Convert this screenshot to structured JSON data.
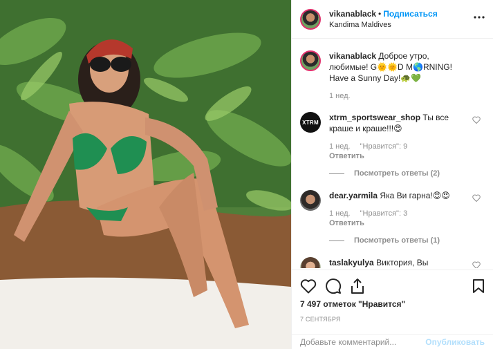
{
  "post": {
    "username": "vikanablack",
    "dot": "•",
    "follow_label": "Подписаться",
    "location": "Kandima Maldives",
    "more_icon": "more-options-icon"
  },
  "caption": {
    "username": "vikanablack",
    "text": "Доброе утро, любимые! G🌞🌞D M🌎RNING! Have a Sunny Day!🐢💚",
    "time": "1 нед."
  },
  "comments": [
    {
      "username": "xtrm_sportswear_shop",
      "text": "Ты все краше и краше!!!😍",
      "time": "1 нед.",
      "likes": "\"Нравится\": 9",
      "reply": "Ответить",
      "view_replies": "Посмотреть ответы (2)",
      "avatar_text": "XTRM"
    },
    {
      "username": "dear.yarmila",
      "text": "Яка Ви гарна!😍😍",
      "time": "1 нед.",
      "likes": "\"Нравится\": 3",
      "reply": "Ответить",
      "view_replies": "Посмотреть ответы (1)"
    },
    {
      "username": "taslakyulya",
      "text": "Виктория, Вы нереально красива!!!❤️❤️"
    }
  ],
  "footer": {
    "likes": "7 497 отметок \"Нравится\"",
    "date": "7 СЕНТЯБРЯ",
    "comment_placeholder": "Добавьте комментарий...",
    "publish_label": "Опубликовать"
  },
  "colors": {
    "link": "#0095f6",
    "muted": "#8e8e8e",
    "text": "#262626"
  }
}
